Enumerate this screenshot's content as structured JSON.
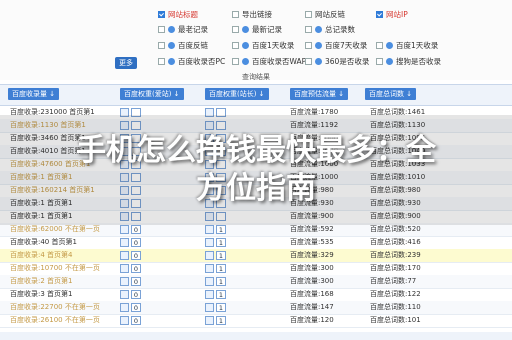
{
  "options": [
    {
      "label": "网站标题",
      "checked": true,
      "red": true
    },
    {
      "label": "导出链接",
      "checked": false
    },
    {
      "label": "网站反链",
      "checked": false
    },
    {
      "label": "网站IP",
      "checked": true,
      "red": true
    },
    {
      "label": "最老记录",
      "checked": false
    },
    {
      "label": "最新记录",
      "checked": false
    },
    {
      "label": "总记录数",
      "checked": false
    },
    {
      "label": "百度反链",
      "checked": false
    },
    {
      "label": "百度1天收录",
      "checked": false
    },
    {
      "label": "百度7天收录",
      "checked": false
    },
    {
      "label": "百度1天收录",
      "checked": false
    },
    {
      "label": "百度收录否PC",
      "checked": false
    },
    {
      "label": "百度收录否WAP",
      "checked": false
    },
    {
      "label": "360是否收录",
      "checked": false
    },
    {
      "label": "搜狗是否收录",
      "checked": false
    }
  ],
  "more_label": "更多",
  "query_label": "查询结果",
  "headers": [
    "百度收录量 ↓",
    "百度权重(爱站) ↓",
    "百度权重(站长) ↓",
    "百度预估流量 ↓",
    "百度总词数 ↓"
  ],
  "rows": [
    {
      "c1": "百度收录:231000 首页第1",
      "v2": "",
      "v3": "",
      "c4": "百度流量:1780",
      "c5": "百度总词数:1461",
      "faded": false
    },
    {
      "c1": "百度收录:1130 首页第1",
      "v2": "",
      "v3": "",
      "c4": "百度流量:1192",
      "c5": "百度总词数:1130",
      "faded": true
    },
    {
      "c1": "百度收录:3460 首页第1",
      "v2": "",
      "v3": "",
      "c4": "百度流量:1000",
      "c5": "百度总词数:1095",
      "faded": false
    },
    {
      "c1": "百度收录:4010 首页第1",
      "v2": "",
      "v3": "",
      "c4": "百度流量:1000",
      "c5": "百度总词数:1040",
      "faded": false
    },
    {
      "c1": "百度收录:47600 首页第1",
      "v2": "",
      "v3": "",
      "c4": "百度流量:1000",
      "c5": "百度总词数:1033",
      "faded": true
    },
    {
      "c1": "百度收录:1 首页第1",
      "v2": "",
      "v3": "",
      "c4": "百度流量:1000",
      "c5": "百度总词数:1010",
      "faded": true
    },
    {
      "c1": "百度收录:160214 首页第1",
      "v2": "",
      "v3": "",
      "c4": "百度流量:980",
      "c5": "百度总词数:980",
      "faded": true
    },
    {
      "c1": "百度收录:1 首页第1",
      "v2": "",
      "v3": "",
      "c4": "百度流量:930",
      "c5": "百度总词数:930",
      "faded": false
    },
    {
      "c1": "百度收录:1 首页第1",
      "v2": "",
      "v3": "",
      "c4": "百度流量:900",
      "c5": "百度总词数:900",
      "faded": false
    },
    {
      "c1": "百度收录:62000 不在第一页",
      "v2": "0",
      "v3": "1",
      "c4": "百度流量:592",
      "c5": "百度总词数:520",
      "faded": true
    },
    {
      "c1": "百度收录:40 首页第1",
      "v2": "0",
      "v3": "1",
      "c4": "百度流量:535",
      "c5": "百度总词数:416",
      "faded": false
    },
    {
      "c1": "百度收录:4 首页第4",
      "v2": "0",
      "v3": "1",
      "c4": "百度流量:329",
      "c5": "百度总词数:239",
      "faded": true,
      "hl": true
    },
    {
      "c1": "百度收录:10700 不在第一页",
      "v2": "0",
      "v3": "1",
      "c4": "百度流量:300",
      "c5": "百度总词数:170",
      "faded": true
    },
    {
      "c1": "百度收录:2 首页第1",
      "v2": "0",
      "v3": "1",
      "c4": "百度流量:300",
      "c5": "百度总词数:77",
      "faded": true
    },
    {
      "c1": "百度收录:3 首页第1",
      "v2": "0",
      "v3": "1",
      "c4": "百度流量:168",
      "c5": "百度总词数:122",
      "faded": false
    },
    {
      "c1": "百度收录:22700 不在第一页",
      "v2": "0",
      "v3": "1",
      "c4": "百度流量:147",
      "c5": "百度总词数:110",
      "faded": true
    },
    {
      "c1": "百度收录:26100 不在第一页",
      "v2": "0",
      "v3": "1",
      "c4": "百度流量:120",
      "c5": "百度总词数:101",
      "faded": true
    }
  ],
  "overlay_title": "手机怎么挣钱最快最多：全方位指南",
  "overlay_title_line1": "手机怎么挣钱最快最多：全",
  "overlay_title_line2": "方位指南"
}
